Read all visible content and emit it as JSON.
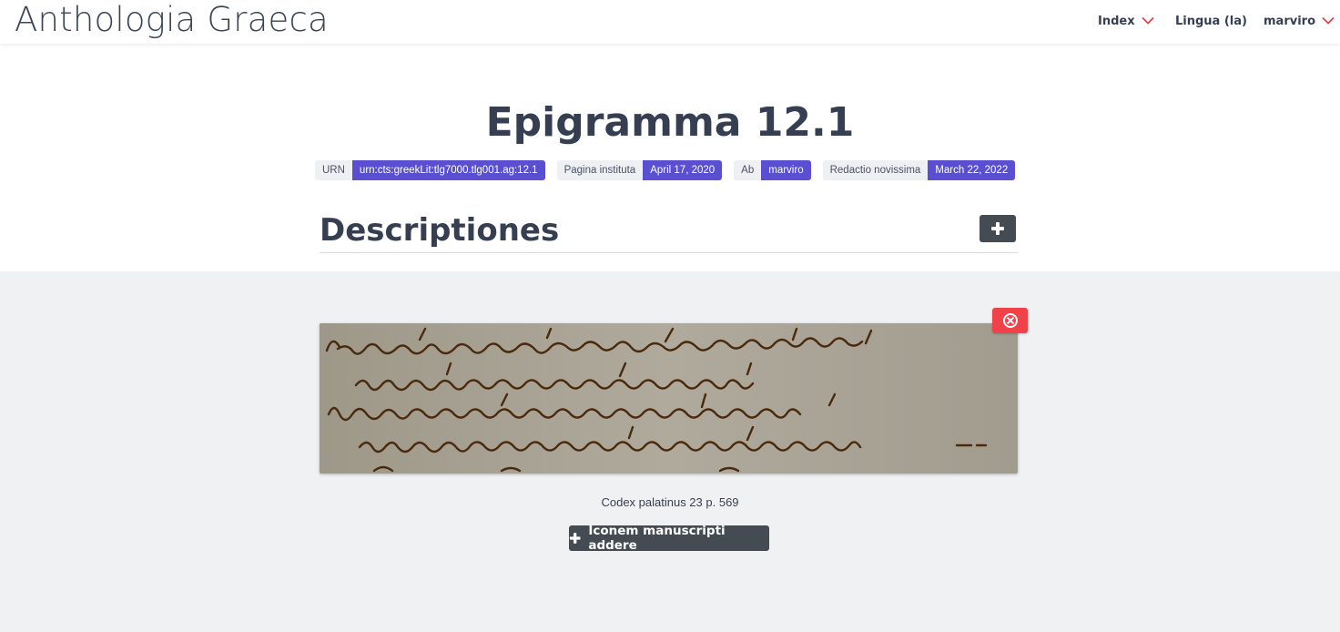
{
  "header": {
    "brand": "Anthologia Graeca",
    "nav": {
      "index_label": "Index",
      "language_label": "Lingua (la)",
      "user_label": "marviro"
    }
  },
  "page": {
    "title": "Epigramma 12.1"
  },
  "meta_tags": [
    {
      "key": "URN",
      "value": "urn:cts:greekLit:tlg7000.tlg001.ag:12.1"
    },
    {
      "key": "Pagina instituta",
      "value": "April 17, 2020"
    },
    {
      "key": "Ab",
      "value": "marviro"
    },
    {
      "key": "Redactio novissima",
      "value": "March 22, 2022"
    }
  ],
  "descriptions": {
    "title": "Descriptiones"
  },
  "manuscript": {
    "caption": "Codex palatinus 23 p. 569",
    "add_button_label": "Iconem manuscripti addere"
  },
  "colors": {
    "accent": "#5a4fd0",
    "danger": "#f1424a",
    "dark_button": "#454b53",
    "chevron": "#e0424b",
    "ink": "#4a2a0c",
    "parchment": "#a7a194"
  },
  "icons": {
    "nav_chevron": "chevron-down-icon",
    "add": "plus-icon",
    "remove": "close-circle-icon"
  }
}
